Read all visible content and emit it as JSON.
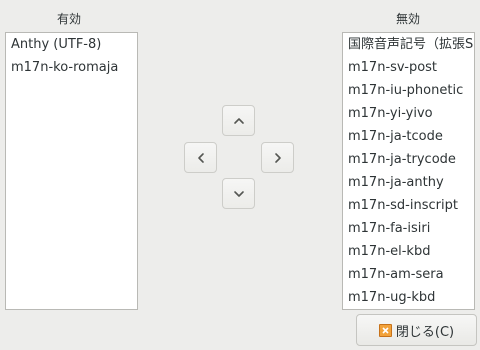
{
  "labels": {
    "enabled": "有効",
    "disabled": "無効"
  },
  "enabled_list": [
    "Anthy (UTF-8)",
    "m17n-ko-romaja"
  ],
  "disabled_list": [
    "国際音声記号（拡張S",
    "m17n-sv-post",
    "m17n-iu-phonetic",
    "m17n-yi-yivo",
    "m17n-ja-tcode",
    "m17n-ja-trycode",
    "m17n-ja-anthy",
    "m17n-sd-inscript",
    "m17n-fa-isiri",
    "m17n-el-kbd",
    "m17n-am-sera",
    "m17n-ug-kbd"
  ],
  "buttons": {
    "close_label": "閉じる(C)"
  },
  "icons": {
    "move_up": "chevron-up-icon",
    "move_left": "chevron-left-icon",
    "move_right": "chevron-right-icon",
    "move_down": "chevron-down-icon",
    "close": "close-icon"
  },
  "colors": {
    "background": "#ededeb",
    "list_background": "#ffffff",
    "close_icon": "#f2a23a"
  }
}
